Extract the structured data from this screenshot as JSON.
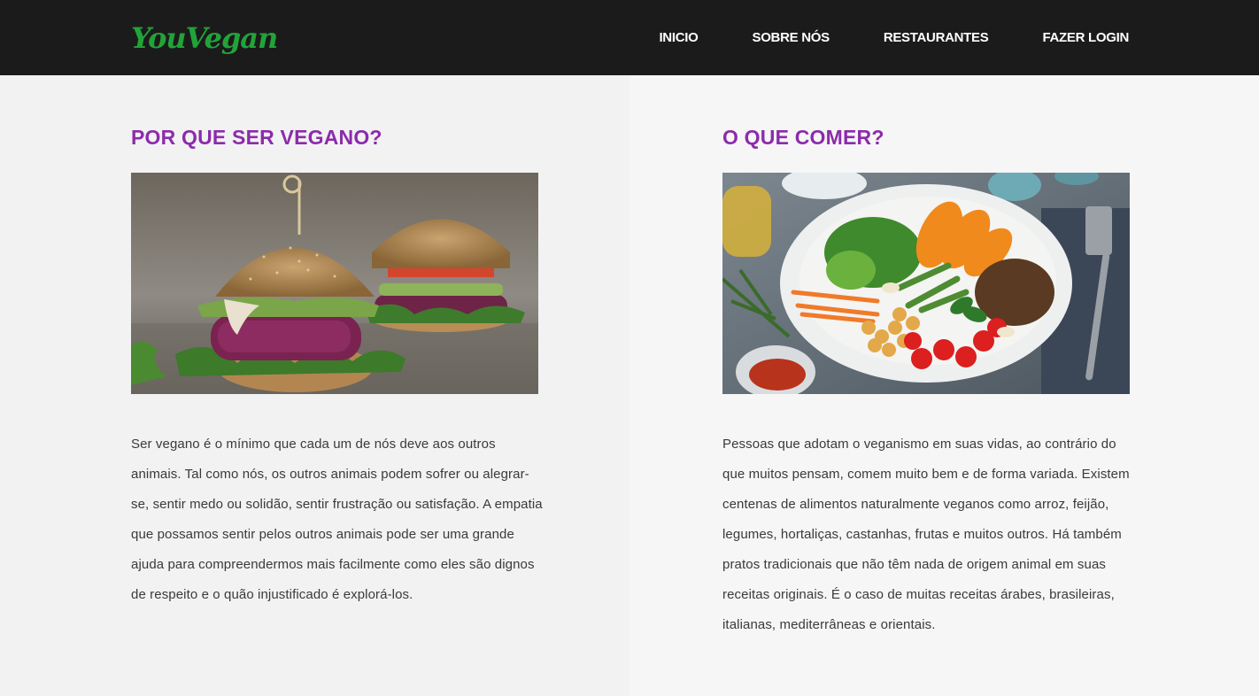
{
  "header": {
    "logo": "YouVegan",
    "nav": [
      {
        "label": "INICIO"
      },
      {
        "label": "SOBRE NÓS"
      },
      {
        "label": "RESTAURANTES"
      },
      {
        "label": "FAZER LOGIN"
      }
    ]
  },
  "sections": [
    {
      "title": "POR QUE SER VEGANO?",
      "image_icon": "veggie-burgers-photo",
      "text": "Ser vegano é o mínimo que cada um de nós deve aos outros animais. Tal como nós, os outros animais podem sofrer ou alegrar-se, sentir medo ou solidão, sentir frustração ou satisfação. A empatia que possamos sentir pelos outros animais pode ser uma grande ajuda para compreendermos mais facilmente como eles são dignos de respeito e o quão injustificado é explorá-los."
    },
    {
      "title": "O QUE COMER?",
      "image_icon": "vegan-bowl-photo",
      "text": "Pessoas que adotam o veganismo em suas vidas, ao contrário do que muitos pensam, comem muito bem e de forma variada. Existem centenas de alimentos naturalmente veganos como arroz, feijão, legumes, hortaliças, castanhas, frutas e muitos outros. Há também pratos tradicionais que não têm nada de origem animal em suas receitas originais. É o caso de muitas receitas árabes, brasileiras, italianas, mediterrâneas e orientais."
    }
  ],
  "colors": {
    "header_bg": "#1b1b1b",
    "logo": "#22a33a",
    "title": "#8c2bab"
  }
}
